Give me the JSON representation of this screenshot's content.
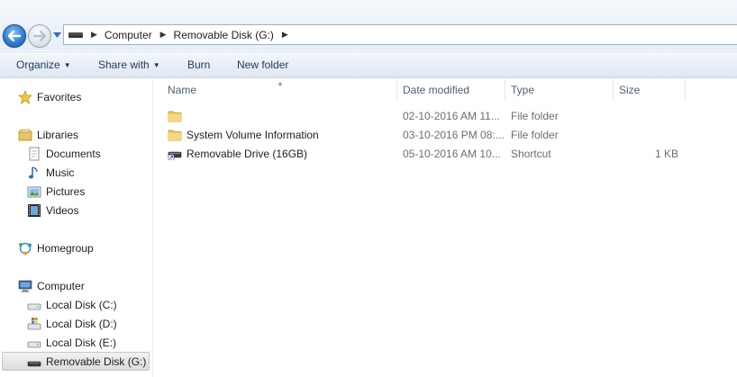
{
  "address_bar": {
    "breadcrumbs": [
      "Computer",
      "Removable Disk (G:)"
    ]
  },
  "command_bar": {
    "organize": "Organize",
    "share_with": "Share with",
    "burn": "Burn",
    "new_folder": "New folder"
  },
  "nav_pane": {
    "favorites": "Favorites",
    "libraries": "Libraries",
    "documents": "Documents",
    "music": "Music",
    "pictures": "Pictures",
    "videos": "Videos",
    "homegroup": "Homegroup",
    "computer": "Computer",
    "drive_c": "Local Disk (C:)",
    "drive_d": "Local Disk (D:)",
    "drive_e": "Local Disk (E:)",
    "drive_g": "Removable Disk (G:)"
  },
  "columns": {
    "name": "Name",
    "date_modified": "Date modified",
    "type": "Type",
    "size": "Size"
  },
  "files": [
    {
      "name": "",
      "date": "02-10-2016 AM 11...",
      "type": "File folder",
      "size": "",
      "icon": "folder-icon"
    },
    {
      "name": "System Volume Information",
      "date": "03-10-2016 PM 08:...",
      "type": "File folder",
      "size": "",
      "icon": "folder-icon"
    },
    {
      "name": "Removable Drive (16GB)",
      "date": "05-10-2016 AM 10...",
      "type": "Shortcut",
      "size": "1 KB",
      "icon": "shortcut-icon"
    }
  ],
  "colors": {
    "accent": "#1e395b",
    "column_header": "#4c607a",
    "folder": "#e8c25a"
  }
}
